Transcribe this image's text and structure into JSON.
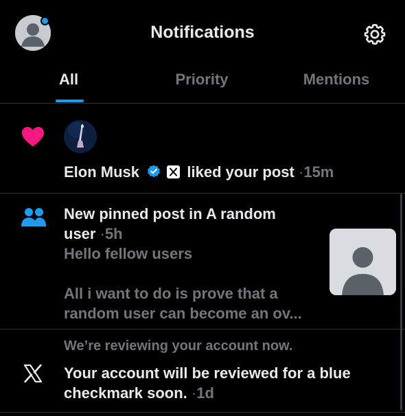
{
  "header": {
    "title": "Notifications",
    "avatar_icon": "default-avatar-icon",
    "settings_icon": "gear-icon",
    "accent_color": "#1d9bf0"
  },
  "tabs": [
    {
      "label": "All",
      "active": true
    },
    {
      "label": "Priority",
      "active": false
    },
    {
      "label": "Mentions",
      "active": false
    }
  ],
  "notifications": [
    {
      "type": "like",
      "icon": "heart-icon",
      "icon_color": "#f91880",
      "user": "Elon Musk",
      "verified_icon": "verified-badge-icon",
      "affiliation_icon": "x-logo-icon",
      "action": "liked your post",
      "separator": "·",
      "time": "15m"
    },
    {
      "type": "pinned",
      "icon": "people-icon",
      "icon_color": "#1d9bf0",
      "headline_line1": "New pinned post in A random",
      "headline_line2": "user",
      "separator": "·",
      "time": "5h",
      "preview_line1": "Hello fellow users",
      "preview_line2": "All i want to do is prove that a",
      "preview_line3": "random user can become an ov..."
    },
    {
      "type": "system",
      "icon": "x-logo-icon",
      "subtitle": "We’re reviewing your account now.",
      "message_line1": "Your account will be reviewed for a blue",
      "message_line2": "checkmark soon.",
      "separator": "·",
      "time": "1d"
    }
  ]
}
